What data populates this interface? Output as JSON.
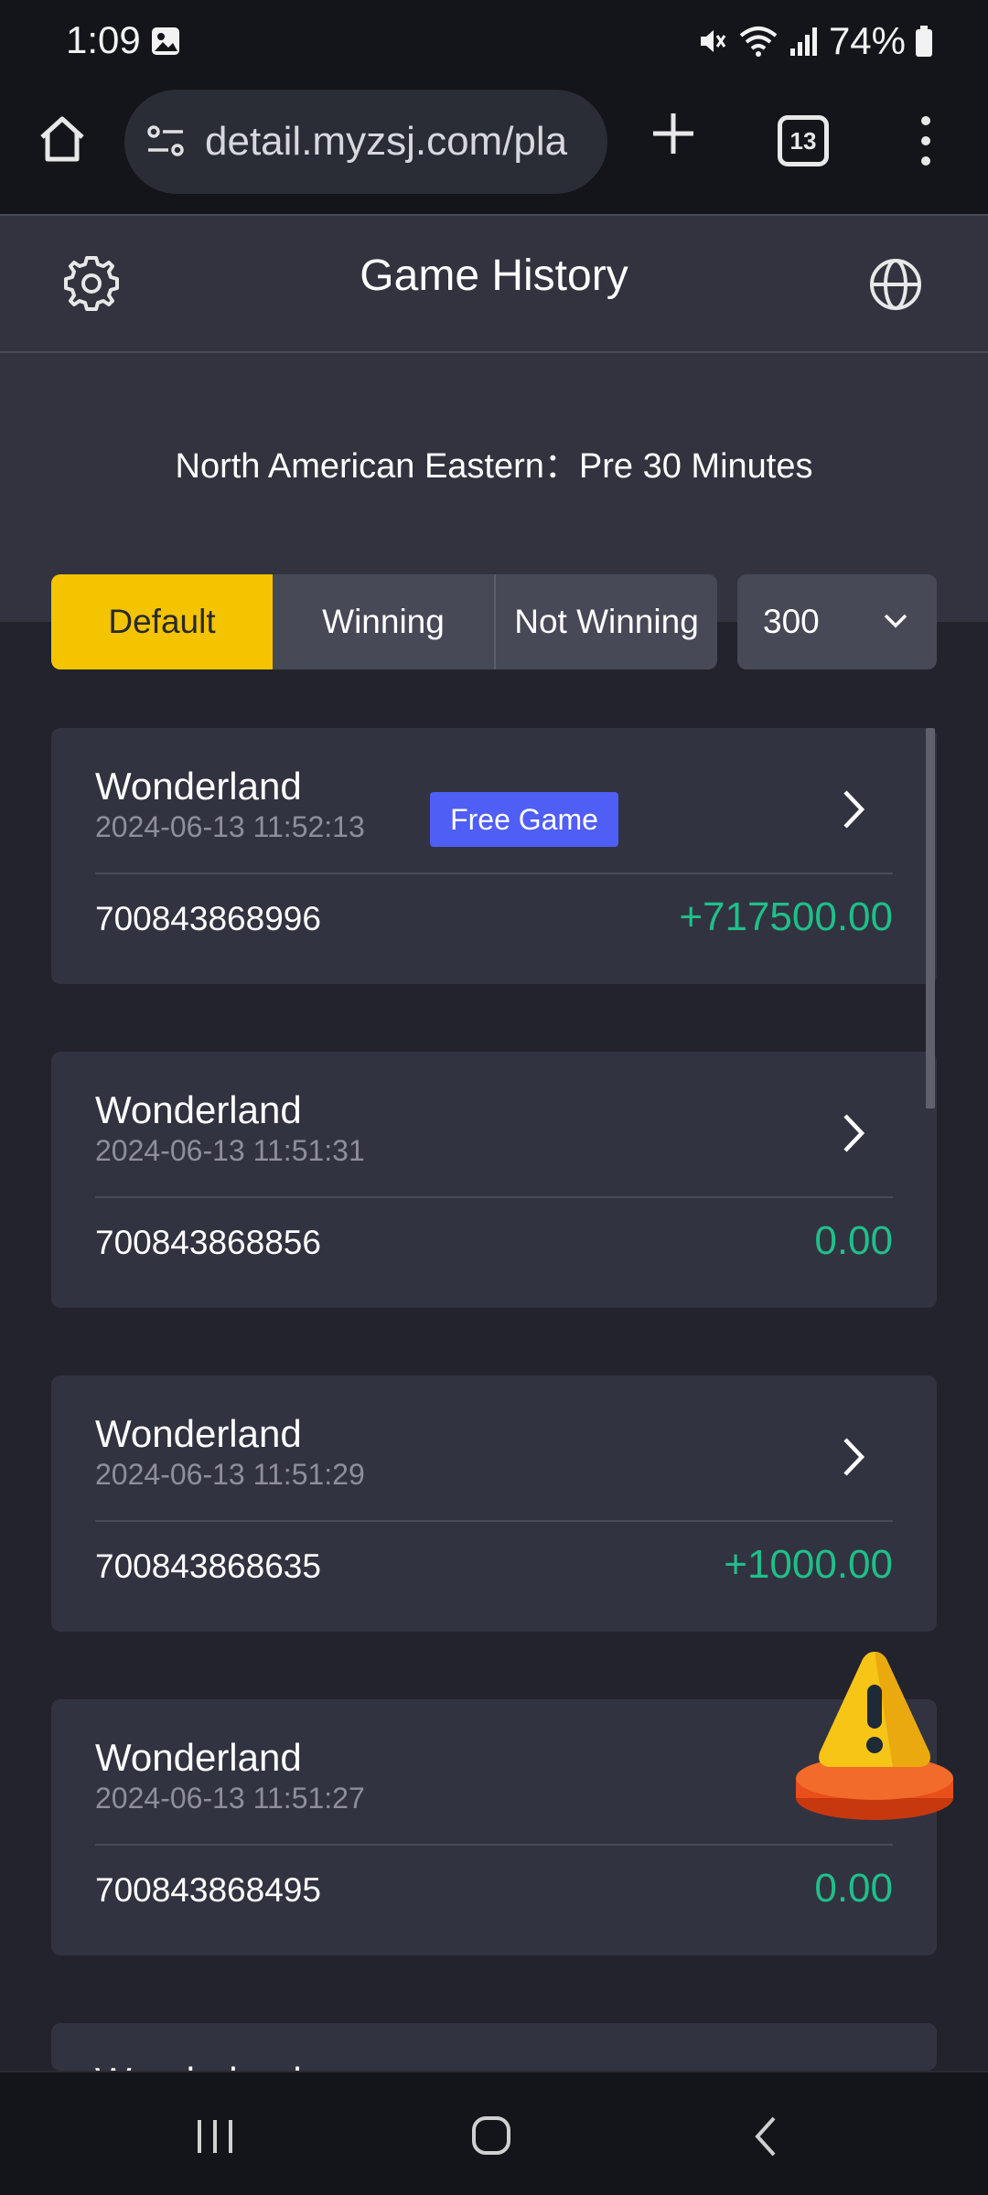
{
  "status": {
    "time": "1:09",
    "battery": "74%"
  },
  "browser": {
    "url": "detail.myzsj.com/pla",
    "tab_count": "13"
  },
  "header": {
    "title": "Game History"
  },
  "timezone_text": "North American Eastern：Pre 30 Minutes",
  "filters": {
    "tabs": [
      {
        "label": "Default",
        "active": true
      },
      {
        "label": "Winning",
        "active": false
      },
      {
        "label": "Not Winning",
        "active": false
      }
    ],
    "count_value": "300"
  },
  "records": [
    {
      "game": "Wonderland",
      "datetime": "2024-06-13 11:52:13",
      "badge": "Free Game",
      "round_id": "700843868996",
      "amount": "+717500.00"
    },
    {
      "game": "Wonderland",
      "datetime": "2024-06-13 11:51:31",
      "round_id": "700843868856",
      "amount": "0.00"
    },
    {
      "game": "Wonderland",
      "datetime": "2024-06-13 11:51:29",
      "round_id": "700843868635",
      "amount": "+1000.00"
    },
    {
      "game": "Wonderland",
      "datetime": "2024-06-13 11:51:27",
      "round_id": "700843868495",
      "amount": "0.00"
    },
    {
      "game": "Wonderland"
    }
  ],
  "colors": {
    "accent_yellow": "#f5c400",
    "win_green": "#1fbf8a",
    "badge_blue": "#4f5ef5"
  }
}
